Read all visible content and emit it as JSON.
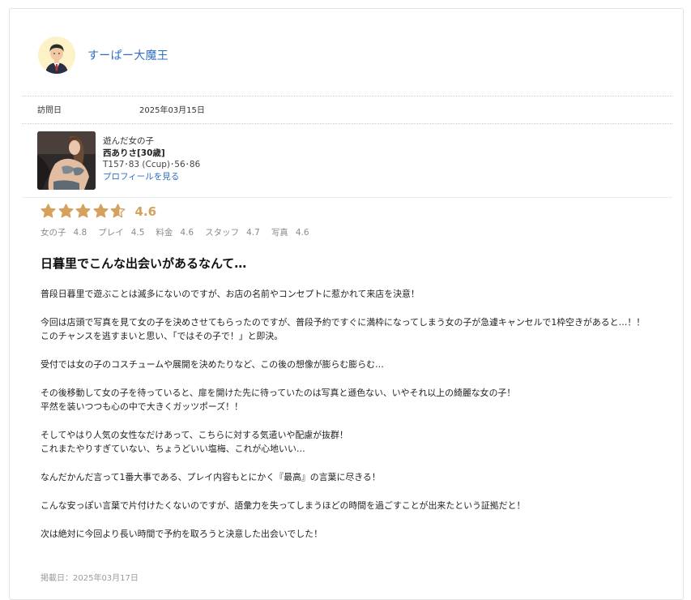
{
  "reviewer": {
    "name": "すーぱー大魔王",
    "avatar": "man-avatar-icon"
  },
  "visit": {
    "label": "訪問日",
    "date": "2025年03月15日"
  },
  "girl": {
    "section_label": "遊んだ女の子",
    "name": "西ありさ[30歳]",
    "specs": "T157･83 (Ccup)･56･86",
    "profile_link": "プロフィールを見る"
  },
  "rating": {
    "overall": "4.6",
    "overall_value": 4.6,
    "stars_max": 5,
    "star_color": "#d6a05d",
    "sub_scores": [
      {
        "label": "女の子",
        "value": "4.8"
      },
      {
        "label": "プレイ",
        "value": "4.5"
      },
      {
        "label": "料金",
        "value": "4.6"
      },
      {
        "label": "スタッフ",
        "value": "4.7"
      },
      {
        "label": "写真",
        "value": "4.6"
      }
    ]
  },
  "review": {
    "title": "日暮里でこんな出会いがあるなんて…",
    "lines": [
      "普段日暮里で遊ぶことは滅多にないのですが、お店の名前やコンセプトに惹かれて来店を決意！",
      "",
      "今回は店頭で写真を見て女の子を決めさせてもらったのですが、普段予約ですぐに満枠になってしまう女の子が急遽キャンセルで1枠空きがあると…！！",
      "このチャンスを逃すまいと思い、「ではその子で！」と即決。",
      "",
      "受付では女の子のコスチュームや展開を決めたりなど、この後の想像が膨らむ膨らむ…",
      "",
      "その後移動して女の子を待っていると、扉を開けた先に待っていたのは写真と遜色ない、いやそれ以上の綺麗な女の子！",
      "平然を装いつつも心の中で大きくガッツポーズ！！",
      "",
      "そしてやはり人気の女性なだけあって、こちらに対する気遣いや配慮が抜群！",
      "これまたやりすぎていない、ちょうどいい塩梅、これが心地いい…",
      "",
      "なんだかんだ言って1番大事である、プレイ内容もとにかく『最高』の言葉に尽きる！",
      "",
      "こんな安っぽい言葉で片付けたくないのですが、語彙力を失ってしまうほどの時間を過ごすことが出来たという証拠だと！",
      "",
      "次は絶対に今回より長い時間で予約を取ろうと決意した出会いでした！"
    ]
  },
  "posted": {
    "text": "掲載日：2025年03月17日"
  }
}
